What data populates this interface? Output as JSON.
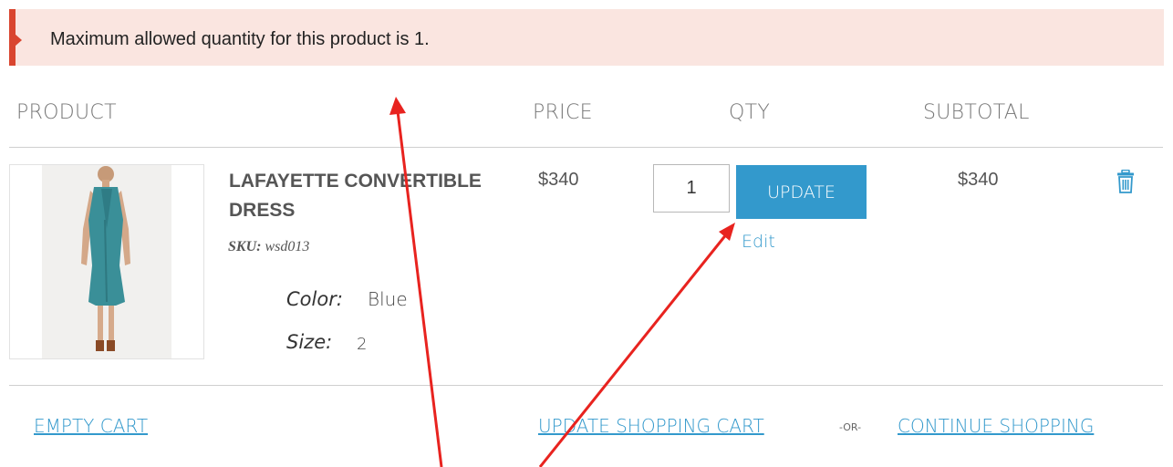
{
  "message": {
    "text": "Maximum allowed quantity for this product is 1.",
    "type": "error"
  },
  "table": {
    "headers": {
      "product": "PRODUCT",
      "price": "PRICE",
      "qty": "QTY",
      "subtotal": "SUBTOTAL"
    },
    "item": {
      "name": "LAFAYETTE CONVERTIBLE DRESS",
      "sku_label": "SKU:",
      "sku": "wsd013",
      "options": [
        {
          "label": "Color:",
          "value": "Blue"
        },
        {
          "label": "Size:",
          "value": "2"
        }
      ],
      "price": "$340",
      "qty": "1",
      "update_label": "UPDATE",
      "edit_label": "Edit",
      "subtotal": "$340",
      "remove_icon": "trash-icon"
    }
  },
  "actions": {
    "empty_cart": "EMPTY CART",
    "update_cart": "UPDATE SHOPPING CART",
    "or": "-OR-",
    "continue_shopping": "CONTINUE SHOPPING"
  },
  "colors": {
    "accent": "#3399cc",
    "error_bg": "#fae5e0",
    "error_border": "#d9452f",
    "annotation_arrow": "#e8231f"
  }
}
